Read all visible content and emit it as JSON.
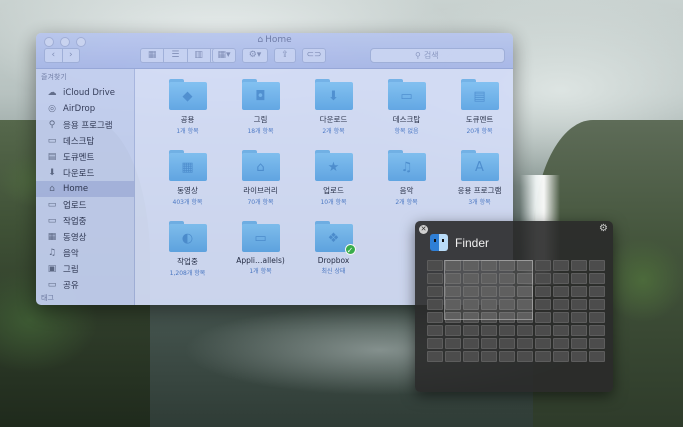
{
  "finder": {
    "title": "Home",
    "search_placeholder": "검색",
    "sidebar": {
      "favorites_header": "즐겨찾기",
      "tags_header": "태그",
      "items": [
        {
          "label": "iCloud Drive",
          "icon": "cloud-icon",
          "glyph": "☁"
        },
        {
          "label": "AirDrop",
          "icon": "airdrop-icon",
          "glyph": "◎"
        },
        {
          "label": "응용 프로그램",
          "icon": "applications-icon",
          "glyph": "⚲"
        },
        {
          "label": "데스크탑",
          "icon": "desktop-icon",
          "glyph": "▭"
        },
        {
          "label": "도큐멘트",
          "icon": "documents-icon",
          "glyph": "▤"
        },
        {
          "label": "다운로드",
          "icon": "downloads-icon",
          "glyph": "⬇"
        },
        {
          "label": "Home",
          "icon": "home-icon",
          "glyph": "⌂"
        },
        {
          "label": "업로드",
          "icon": "folder-icon",
          "glyph": "▭"
        },
        {
          "label": "작업중",
          "icon": "folder-icon",
          "glyph": "▭"
        },
        {
          "label": "동영상",
          "icon": "movies-icon",
          "glyph": "▦"
        },
        {
          "label": "음악",
          "icon": "music-icon",
          "glyph": "♫"
        },
        {
          "label": "그림",
          "icon": "pictures-icon",
          "glyph": "▣"
        },
        {
          "label": "공유",
          "icon": "public-icon",
          "glyph": "▭"
        }
      ],
      "selected_index": 6
    },
    "folders": [
      {
        "label": "공용",
        "meta": "1개 항목",
        "icon": "public-folder-icon",
        "glyph": "◆"
      },
      {
        "label": "그림",
        "meta": "18개 항목",
        "icon": "pictures-folder-icon",
        "glyph": "◘"
      },
      {
        "label": "다운로드",
        "meta": "2개 항목",
        "icon": "downloads-folder-icon",
        "glyph": "⬇"
      },
      {
        "label": "데스크탑",
        "meta": "항목 없음",
        "icon": "desktop-folder-icon",
        "glyph": "▭"
      },
      {
        "label": "도큐멘트",
        "meta": "20개 항목",
        "icon": "documents-folder-icon",
        "glyph": "▤"
      },
      {
        "label": "동영상",
        "meta": "403개 항목",
        "icon": "movies-folder-icon",
        "glyph": "▦"
      },
      {
        "label": "라이브러리",
        "meta": "70개 항목",
        "icon": "library-folder-icon",
        "glyph": "⌂"
      },
      {
        "label": "업로드",
        "meta": "10개 항목",
        "icon": "star-folder-icon",
        "glyph": "★"
      },
      {
        "label": "음악",
        "meta": "2개 항목",
        "icon": "music-folder-icon",
        "glyph": "♫"
      },
      {
        "label": "응용 프로그램",
        "meta": "3개 항목",
        "icon": "applications-folder-icon",
        "glyph": "A"
      },
      {
        "label": "작업중",
        "meta": "1,208개 항목",
        "icon": "generic-folder-icon",
        "glyph": "◐"
      },
      {
        "label": "Appli…allels)",
        "meta": "1개 항목",
        "icon": "parallels-folder-icon",
        "glyph": "▭"
      },
      {
        "label": "Dropbox",
        "meta": "최신 상태",
        "icon": "dropbox-folder-icon",
        "glyph": "❖",
        "synced": true
      }
    ]
  },
  "hud": {
    "app_name": "Finder",
    "grid_columns": 10,
    "grid_rows": 8
  }
}
